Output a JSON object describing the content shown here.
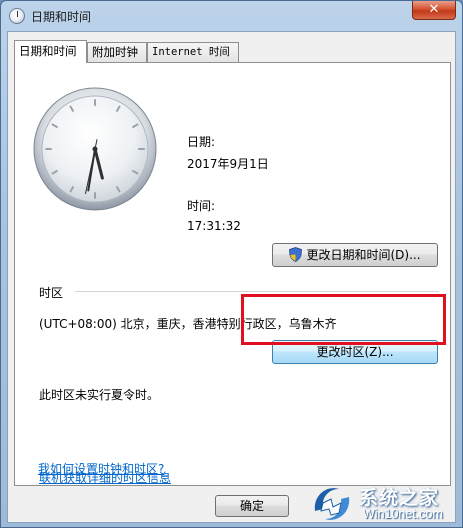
{
  "window": {
    "title": "日期和时间",
    "close_label": "✕"
  },
  "tabs": [
    {
      "label": "日期和时间"
    },
    {
      "label": "附加时钟"
    },
    {
      "label": "Internet 时间"
    }
  ],
  "datetime": {
    "date_label": "日期:",
    "date_value": "2017年9月1日",
    "time_label": "时间:",
    "time_value": "17:31:32",
    "change_datetime_button": "更改日期和时间(D)..."
  },
  "clock": {
    "hour": 17,
    "minute": 31,
    "second": 32
  },
  "timezone": {
    "section_label": "时区",
    "value": "(UTC+08:00) 北京，重庆，香港特别行政区，乌鲁木齐",
    "change_button": "更改时区(Z)...",
    "dst_note": "此时区未实行夏令时。"
  },
  "links": {
    "online_info": "联机获取详细的时区信息",
    "how_to": "我如何设置时钟和时区?"
  },
  "footer": {
    "ok_button": "确定"
  },
  "watermark": {
    "title": "系统之家",
    "subtitle": "Win10net.com"
  },
  "colors": {
    "highlight_box": "#e01020",
    "link": "#0066cc",
    "watermark": "#1b5fa8"
  }
}
